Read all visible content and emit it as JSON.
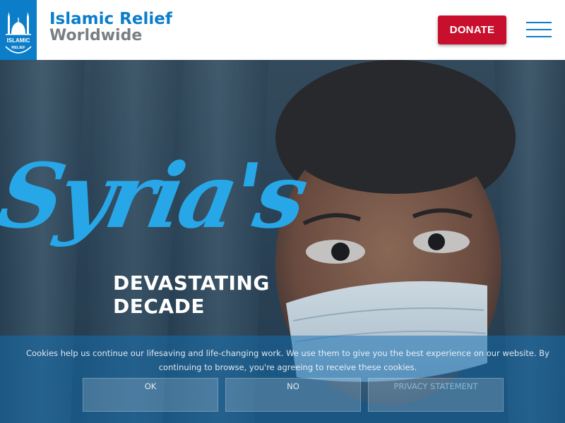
{
  "header": {
    "logo": {
      "text_line1": "ISLAMIC",
      "text_line2": "RELIEF",
      "icon": "mosque-logo-icon"
    },
    "brand_line1": "Islamic Relief",
    "brand_line2": "Worldwide",
    "donate_label": "DONATE",
    "menu_icon": "hamburger-menu-icon"
  },
  "hero": {
    "headline_script": "Syria's",
    "headline_line1": "DEVASTATING",
    "headline_line2": "DECADE"
  },
  "cookie_banner": {
    "message": "Cookies help us continue our lifesaving and life-changing work. We use them to give you the best experience on our website. By continuing to browse, you're agreeing to receive these cookies.",
    "ok_label": "OK",
    "no_label": "NO",
    "privacy_label": "PRIVACY STATEMENT"
  },
  "colors": {
    "brand_blue": "#0b7dc9",
    "brand_grey": "#7b7f83",
    "donate_red": "#c8102e",
    "script_blue": "#27a7e7"
  }
}
